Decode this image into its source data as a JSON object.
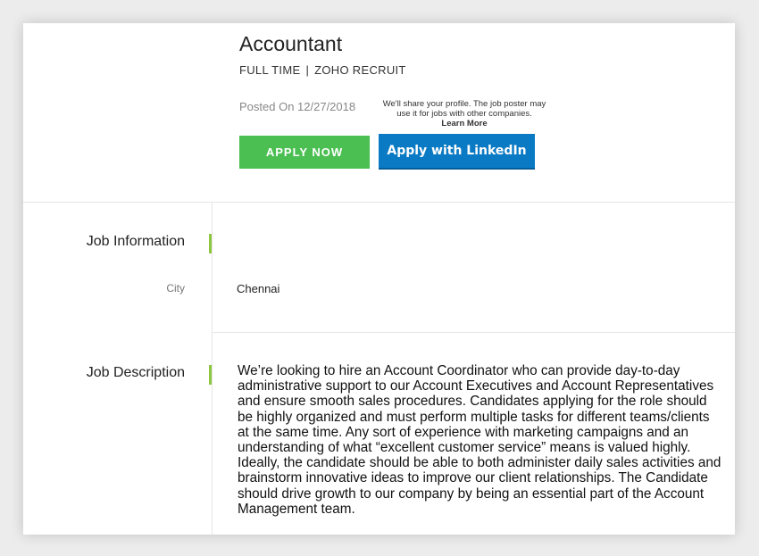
{
  "job": {
    "title": "Accountant",
    "type": "FULL TIME",
    "separator": "|",
    "company": "ZOHO RECRUIT",
    "posted": "Posted On 12/27/2018"
  },
  "share_note": {
    "text": "We'll share your profile. The job poster may use it for jobs with other companies.",
    "learn_more": "Learn More"
  },
  "buttons": {
    "apply_now": "APPLY NOW",
    "apply_linkedin": "Apply with LinkedIn"
  },
  "sections": {
    "job_information": {
      "label": "Job Information",
      "fields": [
        {
          "label": "City",
          "value": "Chennai"
        }
      ]
    },
    "job_description": {
      "label": "Job Description",
      "text": "We’re looking to hire an Account Coordinator who can provide day-to-day administrative support to our Account Executives and Account Representatives and ensure smooth sales procedures. Candidates applying for the role should be highly organized and must perform multiple tasks for different teams/clients at the same time. Any sort of experience with marketing campaigns and an understanding of what “excellent customer service” means is valued highly. Ideally, the candidate should be able to both administer daily sales activities and brainstorm innovative ideas to improve our client relationships. The Candidate should drive growth to our company by being an essential part of the Account Management team."
    }
  },
  "colors": {
    "apply_green": "#4bbf52",
    "linkedin_blue": "#0a7ac4",
    "accent_green": "#8dc63f"
  }
}
